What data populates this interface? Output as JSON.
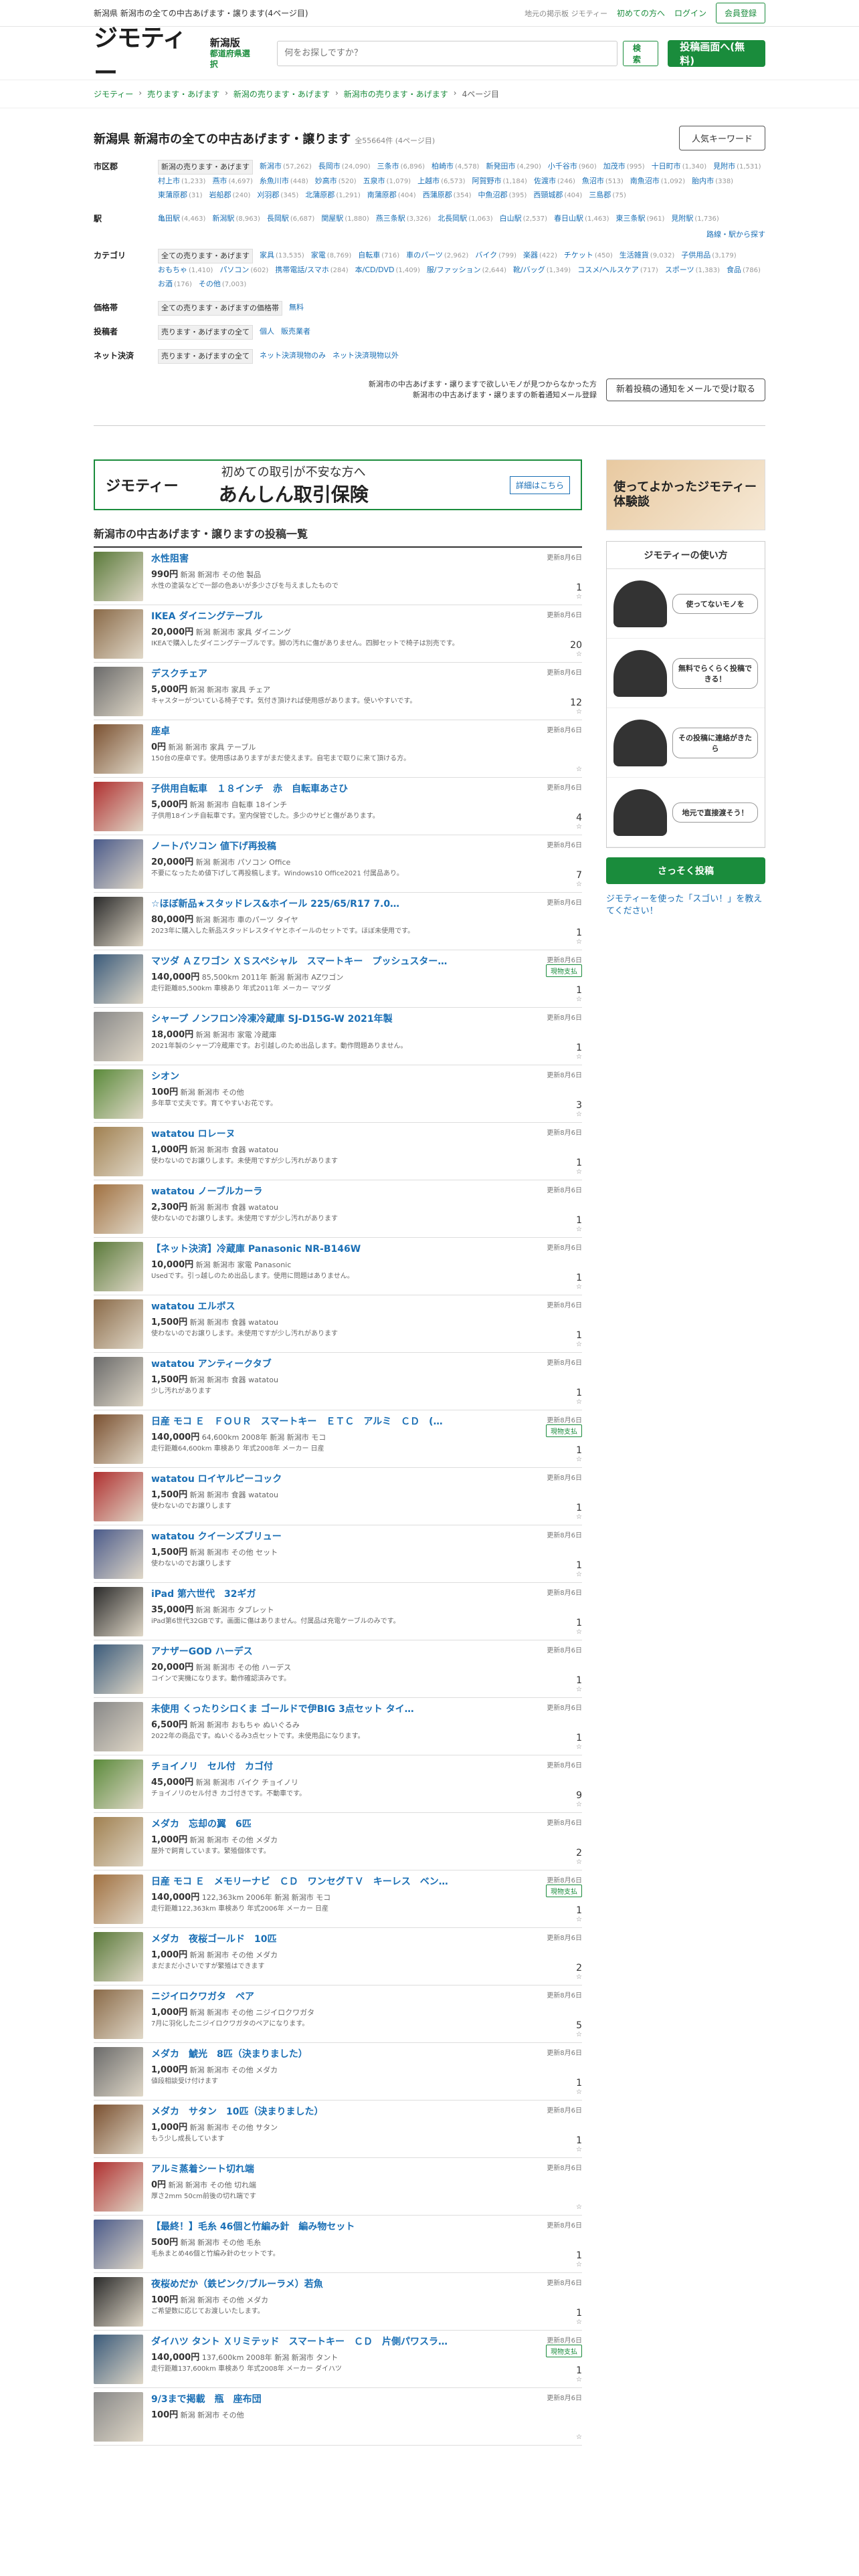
{
  "topbar": {
    "title": "新潟県 新潟市の全ての中古あげます・譲ります(4ページ目)",
    "status": "地元の掲示板 ジモティー",
    "first_time": "初めての方へ",
    "login": "ログイン",
    "register": "会員登録"
  },
  "header": {
    "logo": "ジモティー",
    "logo_sub1": "新潟版",
    "logo_sub2": "都道府県選択",
    "search_placeholder": "何をお探しですか？",
    "search_btn": "検索",
    "post_btn": "投稿画面へ(無料)"
  },
  "crumbs": [
    "ジモティー",
    "売ります・あげます",
    "新潟の売ります・あげます",
    "新潟市の売ります・あげます",
    "4ページ目"
  ],
  "page": {
    "title": "新潟県 新潟市の全ての中古あげます・譲ります",
    "count": "全55664件 (4ページ目)",
    "popular_btn": "人気キーワード"
  },
  "filters": [
    {
      "label": "市区郡",
      "items": [
        {
          "t": "新潟の売ります・あげます",
          "sel": true
        },
        {
          "t": "新潟市",
          "n": "(57,262)"
        },
        {
          "t": "長岡市",
          "n": "(24,090)"
        },
        {
          "t": "三条市",
          "n": "(6,896)"
        },
        {
          "t": "柏崎市",
          "n": "(4,578)"
        },
        {
          "t": "新発田市",
          "n": "(4,290)"
        },
        {
          "t": "小千谷市",
          "n": "(960)"
        },
        {
          "t": "加茂市",
          "n": "(995)"
        },
        {
          "t": "十日町市",
          "n": "(1,340)"
        },
        {
          "t": "見附市",
          "n": "(1,531)"
        },
        {
          "t": "村上市",
          "n": "(1,233)"
        },
        {
          "t": "燕市",
          "n": "(4,697)"
        },
        {
          "t": "糸魚川市",
          "n": "(448)"
        },
        {
          "t": "妙高市",
          "n": "(520)"
        },
        {
          "t": "五泉市",
          "n": "(1,079)"
        },
        {
          "t": "上越市",
          "n": "(6,573)"
        },
        {
          "t": "阿賀野市",
          "n": "(1,184)"
        },
        {
          "t": "佐渡市",
          "n": "(246)"
        },
        {
          "t": "魚沼市",
          "n": "(513)"
        },
        {
          "t": "南魚沼市",
          "n": "(1,092)"
        },
        {
          "t": "胎内市",
          "n": "(338)"
        },
        {
          "t": "東蒲原郡",
          "n": "(31)"
        },
        {
          "t": "岩船郡",
          "n": "(240)"
        },
        {
          "t": "刈羽郡",
          "n": "(345)"
        },
        {
          "t": "北蒲原郡",
          "n": "(1,291)"
        },
        {
          "t": "南蒲原郡",
          "n": "(404)"
        },
        {
          "t": "西蒲原郡",
          "n": "(354)"
        },
        {
          "t": "中魚沼郡",
          "n": "(395)"
        },
        {
          "t": "西頸城郡",
          "n": "(404)"
        },
        {
          "t": "三島郡",
          "n": "(75)"
        }
      ]
    },
    {
      "label": "駅",
      "items": [
        {
          "t": "亀田駅",
          "n": "(4,463)"
        },
        {
          "t": "新潟駅",
          "n": "(8,963)"
        },
        {
          "t": "長岡駅",
          "n": "(6,687)"
        },
        {
          "t": "関屋駅",
          "n": "(1,880)"
        },
        {
          "t": "燕三条駅",
          "n": "(3,326)"
        },
        {
          "t": "北長岡駅",
          "n": "(1,063)"
        },
        {
          "t": "白山駅",
          "n": "(2,537)"
        },
        {
          "t": "春日山駅",
          "n": "(1,463)"
        },
        {
          "t": "東三条駅",
          "n": "(961)"
        },
        {
          "t": "見附駅",
          "n": "(1,736)"
        }
      ]
    },
    {
      "label": "カテゴリ",
      "items": [
        {
          "t": "全ての売ります・あげます",
          "sel": true
        },
        {
          "t": "家具",
          "n": "(13,535)"
        },
        {
          "t": "家電",
          "n": "(8,769)"
        },
        {
          "t": "自転車",
          "n": "(716)"
        },
        {
          "t": "車のパーツ",
          "n": "(2,962)"
        },
        {
          "t": "バイク",
          "n": "(799)"
        },
        {
          "t": "楽器",
          "n": "(422)"
        },
        {
          "t": "チケット",
          "n": "(450)"
        },
        {
          "t": "生活雑貨",
          "n": "(9,032)"
        },
        {
          "t": "子供用品",
          "n": "(3,179)"
        },
        {
          "t": "おもちゃ",
          "n": "(1,410)"
        },
        {
          "t": "パソコン",
          "n": "(602)"
        },
        {
          "t": "携帯電話/スマホ",
          "n": "(284)"
        },
        {
          "t": "本/CD/DVD",
          "n": "(1,409)"
        },
        {
          "t": "服/ファッション",
          "n": "(2,644)"
        },
        {
          "t": "靴/バッグ",
          "n": "(1,349)"
        },
        {
          "t": "コスメ/ヘルスケア",
          "n": "(717)"
        },
        {
          "t": "スポーツ",
          "n": "(1,383)"
        },
        {
          "t": "食品",
          "n": "(786)"
        },
        {
          "t": "お酒",
          "n": "(176)"
        },
        {
          "t": "その他",
          "n": "(7,003)"
        }
      ]
    },
    {
      "label": "価格帯",
      "items": [
        {
          "t": "全ての売ります・あげますの価格帯",
          "sel": true
        },
        {
          "t": "無料"
        }
      ]
    },
    {
      "label": "投稿者",
      "items": [
        {
          "t": "売ります・あげますの全て",
          "sel": true
        },
        {
          "t": "個人"
        },
        {
          "t": "販売業者"
        }
      ]
    },
    {
      "label": "ネット決済",
      "items": [
        {
          "t": "売ります・あげますの全て",
          "sel": true
        },
        {
          "t": "ネット決済現物のみ"
        },
        {
          "t": "ネット決済現物以外"
        }
      ]
    }
  ],
  "more_station": "路線・駅から探す",
  "notify": {
    "line1": "新潟市の中古あげます・譲りますで欲しいモノが見つからなかった方",
    "line2": "新潟市の中古あげます・譲りますの新着通知メール登録",
    "btn": "新着投稿の通知をメールで受け取る"
  },
  "banner": {
    "logo": "ジモティー",
    "t1": "初めての取引が不安な方へ",
    "t2": "あんしん取引保険",
    "link": "詳細はこちら"
  },
  "list_title": "新潟市の中古あげます・譲りますの投稿一覧",
  "items": [
    {
      "title": "水性阻害",
      "price": "990円",
      "loc": "新潟 新潟市 その他 製品",
      "desc": "水性の塗装などで一部の色あいが多少さびを与えましたもので",
      "date": "更新8月6日",
      "count": "1",
      "tag": ""
    },
    {
      "title": "IKEA ダイニングテーブル",
      "price": "20,000円",
      "loc": "新潟 新潟市 家具 ダイニング",
      "desc": "IKEAで購入したダイニングテーブルです。脚の汚れに傷がありません。四脚セットで椅子は別売です。",
      "date": "更新8月6日",
      "count": "20",
      "tag": ""
    },
    {
      "title": "デスクチェア",
      "price": "5,000円",
      "loc": "新潟 新潟市 家具 チェア",
      "desc": "キャスターがついている椅子です。気付き頂ければ使用感があります。使いやすいです。",
      "date": "更新8月6日",
      "count": "12",
      "tag": ""
    },
    {
      "title": "座卓",
      "price": "0円",
      "loc": "新潟 新潟市 家具 テーブル",
      "desc": "150台の座卓です。使用感はありますがまだ使えます。自宅まで取りに来て頂ける方。",
      "date": "更新8月6日",
      "count": "",
      "tag": ""
    },
    {
      "title": "子供用自転車　１８インチ　赤　自転車あさひ",
      "price": "5,000円",
      "loc": "新潟 新潟市 自転車 18インチ",
      "desc": "子供用18インチ自転車です。室内保管でした。多少のサビと傷があります。",
      "date": "更新8月6日",
      "count": "4",
      "tag": ""
    },
    {
      "title": "ノートパソコン 値下げ再投稿",
      "price": "20,000円",
      "loc": "新潟 新潟市 パソコン Office",
      "desc": "不要になったため値下げして再投稿します。Windows10 Office2021 付属品あり。",
      "date": "更新8月6日",
      "count": "7",
      "tag": ""
    },
    {
      "title": "☆ほぼ新品★スタッドレス&ホイール 225/65/R17 7.0…",
      "price": "80,000円",
      "loc": "新潟 新潟市 車のパーツ タイヤ",
      "desc": "2023年に購入した新品スタッドレスタイヤとホイールのセットです。ほぼ未使用です。",
      "date": "更新8月6日",
      "count": "1",
      "tag": ""
    },
    {
      "title": "マツダ ＡＺワゴン ＸＳスペシャル　スマートキー　プッシュスター…",
      "price": "140,000円",
      "loc": "85,500km 2011年 新潟 新潟市 AZワゴン",
      "desc": "走行距離85,500km 車検あり 年式2011年 メーカー マツダ",
      "date": "更新8月6日",
      "count": "1",
      "tag": "現物支払"
    },
    {
      "title": "シャープ ノンフロン冷凍冷蔵庫 SJ-D15G-W 2021年製",
      "price": "18,000円",
      "loc": "新潟 新潟市 家電 冷蔵庫",
      "desc": "2021年製のシャープ冷蔵庫です。お引越しのため出品します。動作問題ありません。",
      "date": "更新8月6日",
      "count": "1",
      "tag": ""
    },
    {
      "title": "シオン",
      "price": "100円",
      "loc": "新潟 新潟市 その他",
      "desc": "多年草で丈夫です。育てやすいお花です。",
      "date": "更新8月6日",
      "count": "3",
      "tag": ""
    },
    {
      "title": "watatou ロレーヌ",
      "price": "1,000円",
      "loc": "新潟 新潟市 食器 watatou",
      "desc": "使わないのでお譲りします。未使用ですが少し汚れがあります",
      "date": "更新8月6日",
      "count": "1",
      "tag": ""
    },
    {
      "title": "watatou ノーブルカーラ",
      "price": "2,300円",
      "loc": "新潟 新潟市 食器 watatou",
      "desc": "使わないのでお譲りします。未使用ですが少し汚れがあります",
      "date": "更新8月6日",
      "count": "1",
      "tag": ""
    },
    {
      "title": "【ネット決済】冷蔵庫 Panasonic NR-B146W",
      "price": "10,000円",
      "loc": "新潟 新潟市 家電 Panasonic",
      "desc": "Usedです。引っ越しのため出品します。使用に問題はありません。",
      "date": "更新8月6日",
      "count": "1",
      "tag": ""
    },
    {
      "title": "watatou エルボス",
      "price": "1,500円",
      "loc": "新潟 新潟市 食器 watatou",
      "desc": "使わないのでお譲りします。未使用ですが少し汚れがあります",
      "date": "更新8月6日",
      "count": "1",
      "tag": ""
    },
    {
      "title": "watatou アンティークタブ",
      "price": "1,500円",
      "loc": "新潟 新潟市 食器 watatou",
      "desc": "少し汚れがあります",
      "date": "更新8月6日",
      "count": "1",
      "tag": ""
    },
    {
      "title": "日産 モコ Ｅ　ＦＯＵＲ　スマートキー　ＥＴＣ　アルミ　ＣＤ　(…",
      "price": "140,000円",
      "loc": "64,600km 2008年 新潟 新潟市 モコ",
      "desc": "走行距離64,600km 車検あり 年式2008年 メーカー 日産",
      "date": "更新8月6日",
      "count": "1",
      "tag": "現物支払"
    },
    {
      "title": "watatou ロイヤルピーコック",
      "price": "1,500円",
      "loc": "新潟 新潟市 食器 watatou",
      "desc": "使わないのでお譲りします",
      "date": "更新8月6日",
      "count": "1",
      "tag": ""
    },
    {
      "title": "watatou クイーンズブリュー",
      "price": "1,500円",
      "loc": "新潟 新潟市 その他 セット",
      "desc": "使わないのでお譲りします",
      "date": "更新8月6日",
      "count": "1",
      "tag": ""
    },
    {
      "title": "iPad 第六世代　32ギガ",
      "price": "35,000円",
      "loc": "新潟 新潟市 タブレット",
      "desc": "iPad第6世代32GBです。画面に傷はありません。付属品は充電ケーブルのみです。",
      "date": "更新8月6日",
      "count": "1",
      "tag": ""
    },
    {
      "title": "アナザーGOD ハーデス",
      "price": "20,000円",
      "loc": "新潟 新潟市 その他 ハーデス",
      "desc": "コインで実機になります。動作確認済みです。",
      "date": "更新8月6日",
      "count": "1",
      "tag": ""
    },
    {
      "title": "未使用 くったりシロくま ゴールドで伊BIG 3点セット タイ…",
      "price": "6,500円",
      "loc": "新潟 新潟市 おもちゃ ぬいぐるみ",
      "desc": "2022年の商品です。ぬいぐるみ3点セットです。未使用品になります。",
      "date": "更新8月6日",
      "count": "1",
      "tag": ""
    },
    {
      "title": "チョイノリ　セル付　カゴ付",
      "price": "45,000円",
      "loc": "新潟 新潟市 バイク チョイノリ",
      "desc": "チョイノリのセル付き カゴ付きです。不動車です。",
      "date": "更新8月6日",
      "count": "9",
      "tag": ""
    },
    {
      "title": "メダカ　忘却の翼　6匹",
      "price": "1,000円",
      "loc": "新潟 新潟市 その他 メダカ",
      "desc": "屋外で飼育しています。繁殖個体です。",
      "date": "更新8月6日",
      "count": "2",
      "tag": ""
    },
    {
      "title": "日産 モコ Ｅ　メモリーナビ　ＣＤ　ワンセグＴＶ　キーレス　ベン…",
      "price": "140,000円",
      "loc": "122,363km 2006年 新潟 新潟市 モコ",
      "desc": "走行距離122,363km 車検あり 年式2006年 メーカー 日産",
      "date": "更新8月6日",
      "count": "1",
      "tag": "現物支払"
    },
    {
      "title": "メダカ　夜桜ゴールド　10匹",
      "price": "1,000円",
      "loc": "新潟 新潟市 その他 メダカ",
      "desc": "まだまだ小さいですが繁殖はできます",
      "date": "更新8月6日",
      "count": "2",
      "tag": ""
    },
    {
      "title": "ニジイロクワガタ　ペア",
      "price": "1,000円",
      "loc": "新潟 新潟市 その他 ニジイロクワガタ",
      "desc": "7月に羽化したニジイロクワガタのペアになります。",
      "date": "更新8月6日",
      "count": "5",
      "tag": ""
    },
    {
      "title": "メダカ　鯱光　8匹（決まりました）",
      "price": "1,000円",
      "loc": "新潟 新潟市 その他 メダカ",
      "desc": "値段相談受け付けます",
      "date": "更新8月6日",
      "count": "1",
      "tag": ""
    },
    {
      "title": "メダカ　サタン　10匹（決まりました）",
      "price": "1,000円",
      "loc": "新潟 新潟市 その他 サタン",
      "desc": "もう少し成長しています",
      "date": "更新8月6日",
      "count": "1",
      "tag": ""
    },
    {
      "title": "アルミ蒸着シート切れ端",
      "price": "0円",
      "loc": "新潟 新潟市 その他 切れ端",
      "desc": "厚さ2mm 50cm前後の切れ端です",
      "date": "更新8月6日",
      "count": "",
      "tag": ""
    },
    {
      "title": "【最終！】毛糸 46個と竹編み針　編み物セット",
      "price": "500円",
      "loc": "新潟 新潟市 その他 毛糸",
      "desc": "毛糸まとめ46個と竹編み針のセットです。",
      "date": "更新8月6日",
      "count": "1",
      "tag": ""
    },
    {
      "title": "夜桜めだか（鉄ピンク/ブルーラメ）若魚",
      "price": "100円",
      "loc": "新潟 新潟市 その他 メダカ",
      "desc": "ご希望数に応じてお渡しいたします。",
      "date": "更新8月6日",
      "count": "1",
      "tag": ""
    },
    {
      "title": "ダイハツ タント Ｘリミテッド　スマートキー　ＣＤ　片側パワスラ…",
      "price": "140,000円",
      "loc": "137,600km 2008年 新潟 新潟市 タント",
      "desc": "走行距離137,600km 車検あり 年式2008年 メーカー ダイハツ",
      "date": "更新8月6日",
      "count": "1",
      "tag": "現物支払"
    },
    {
      "title": "9/3まで掲載　瓶　座布団",
      "price": "100円",
      "loc": "新潟 新潟市 その他",
      "desc": "",
      "date": "更新8月6日",
      "count": "",
      "tag": ""
    }
  ],
  "sidebar": {
    "ad_text": "使ってよかったジモティー体験談",
    "howto_title": "ジモティーの使い方",
    "steps": [
      "使ってないモノを",
      "無料でらくらく投稿できる！",
      "その投稿に連絡がきたら",
      "地元で直接渡そう！"
    ],
    "start_btn": "さっそく投稿",
    "link": "ジモティーを使った「スゴい！」を教えてください！"
  }
}
